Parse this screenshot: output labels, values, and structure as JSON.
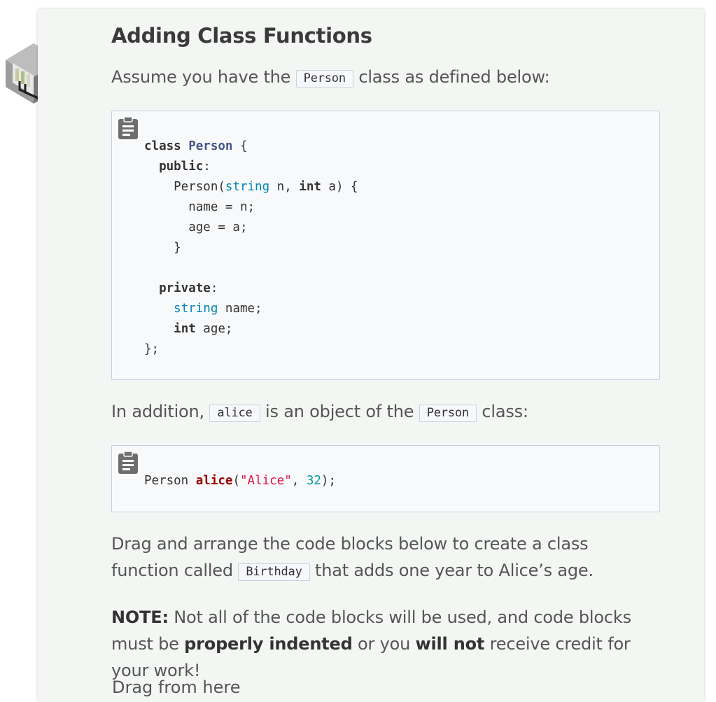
{
  "title": "Adding Class Functions",
  "intro": {
    "before": "Assume you have the ",
    "code": "Person",
    "after": " class as defined below:"
  },
  "code_block_1": {
    "icon": "clipboard-icon",
    "lines": [
      [
        [
          "class ",
          "kw"
        ],
        [
          "Person",
          "cls"
        ],
        [
          " {",
          ""
        ]
      ],
      [
        [
          "  ",
          ""
        ],
        [
          "public",
          "kw"
        ],
        [
          ":",
          ""
        ]
      ],
      [
        [
          "    Person(",
          ""
        ],
        [
          "string",
          "ty"
        ],
        [
          " n, ",
          ""
        ],
        [
          "int",
          "kw"
        ],
        [
          " a) {",
          ""
        ]
      ],
      [
        [
          "      name = n;",
          ""
        ]
      ],
      [
        [
          "      age = a;",
          ""
        ]
      ],
      [
        [
          "    }",
          ""
        ]
      ],
      [
        [
          "",
          ""
        ]
      ],
      [
        [
          "  ",
          ""
        ],
        [
          "private",
          "kw"
        ],
        [
          ":",
          ""
        ]
      ],
      [
        [
          "    ",
          ""
        ],
        [
          "string",
          "ty"
        ],
        [
          " name;",
          ""
        ]
      ],
      [
        [
          "    ",
          ""
        ],
        [
          "int",
          "kw"
        ],
        [
          " age;",
          ""
        ]
      ],
      [
        [
          "};",
          ""
        ]
      ]
    ]
  },
  "addition": {
    "p1": "In addition, ",
    "code1": "alice",
    "p2": " is an object of the ",
    "code2": "Person",
    "p3": " class:"
  },
  "code_block_2": {
    "icon": "clipboard-icon",
    "lines": [
      [
        [
          "Person ",
          ""
        ],
        [
          "alice",
          "fn"
        ],
        [
          "(",
          ""
        ],
        [
          "\"Alice\"",
          "str"
        ],
        [
          ", ",
          ""
        ],
        [
          "32",
          "num"
        ],
        [
          ");",
          ""
        ]
      ]
    ]
  },
  "drag": {
    "p1": "Drag and arrange the code blocks below to create a class function called ",
    "code": "Birthday",
    "p2": " that adds one year to Alice’s age."
  },
  "note": {
    "label": "NOTE:",
    "t1": " Not all of the code blocks will be used, and code blocks must be ",
    "b1": "properly indented",
    "t2": " or you ",
    "b2": "will not",
    "t3": " receive credit for your work!"
  },
  "cutoff_text": "Drag from here"
}
